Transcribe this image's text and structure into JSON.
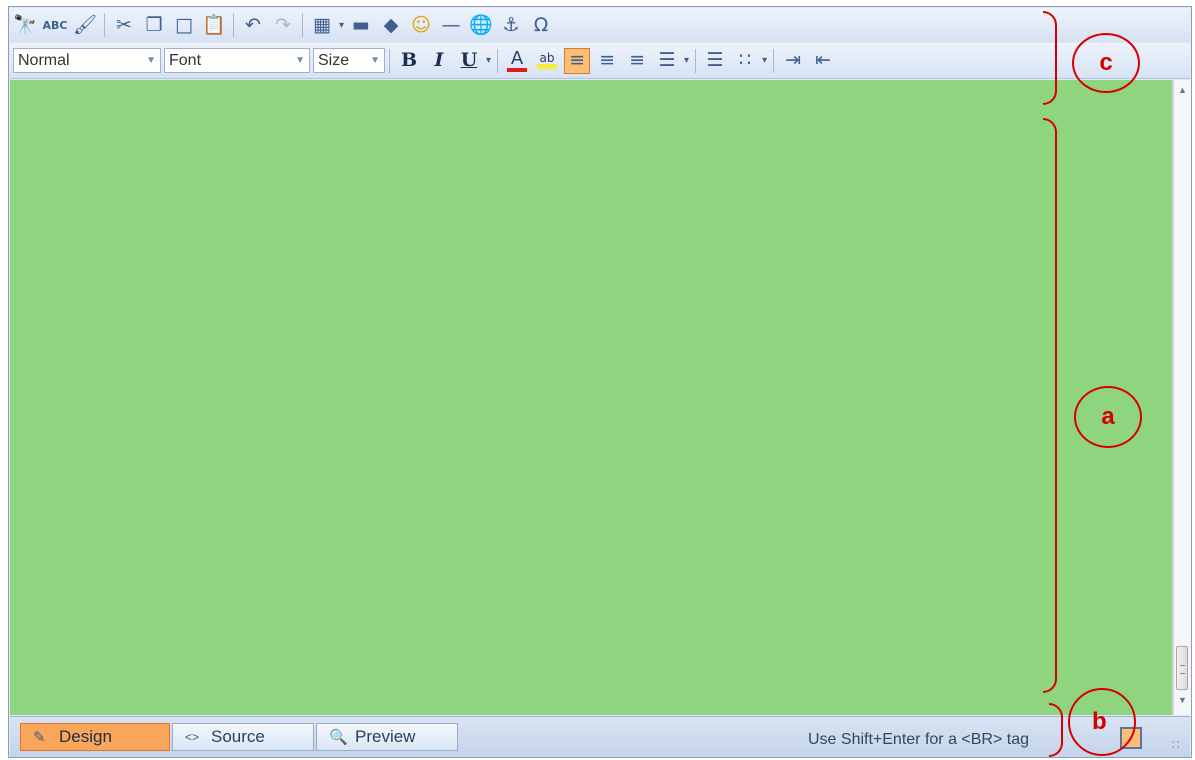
{
  "toolbar_row1": {
    "icons": [
      "find-replace-icon",
      "spellcheck-icon",
      "format-stripper-icon",
      "cut-icon",
      "copy-icon",
      "paste-icon",
      "paste-from-word-icon",
      "undo-icon",
      "redo-icon",
      "insert-table-icon",
      "insert-image-icon",
      "insert-flash-icon",
      "emoticon-icon",
      "horizontal-rule-icon",
      "hyperlink-icon",
      "anchor-icon",
      "special-characters-icon"
    ],
    "special_char_glyph": "Ω"
  },
  "toolbar_row2": {
    "paragraph_style": "Normal",
    "font_name": "Font",
    "font_size": "Size",
    "bold_glyph": "B",
    "italic_glyph": "I",
    "underline_glyph": "U",
    "font_color_glyph": "A",
    "highlight_glyph": "ab",
    "active_alignment": "align-left"
  },
  "bottom_bar": {
    "tabs": [
      {
        "label": "Design",
        "active": true
      },
      {
        "label": "Source",
        "active": false
      },
      {
        "label": "Preview",
        "active": false
      }
    ],
    "status_text": "Use Shift+Enter for a <BR> tag"
  },
  "annotations": {
    "a": "a",
    "b": "b",
    "c": "c"
  },
  "colors": {
    "content_background": "#8fd47e",
    "toolbar_blue": "#d6e2f3",
    "active_orange": "#f9a55a",
    "annotation_red": "#d60000"
  }
}
